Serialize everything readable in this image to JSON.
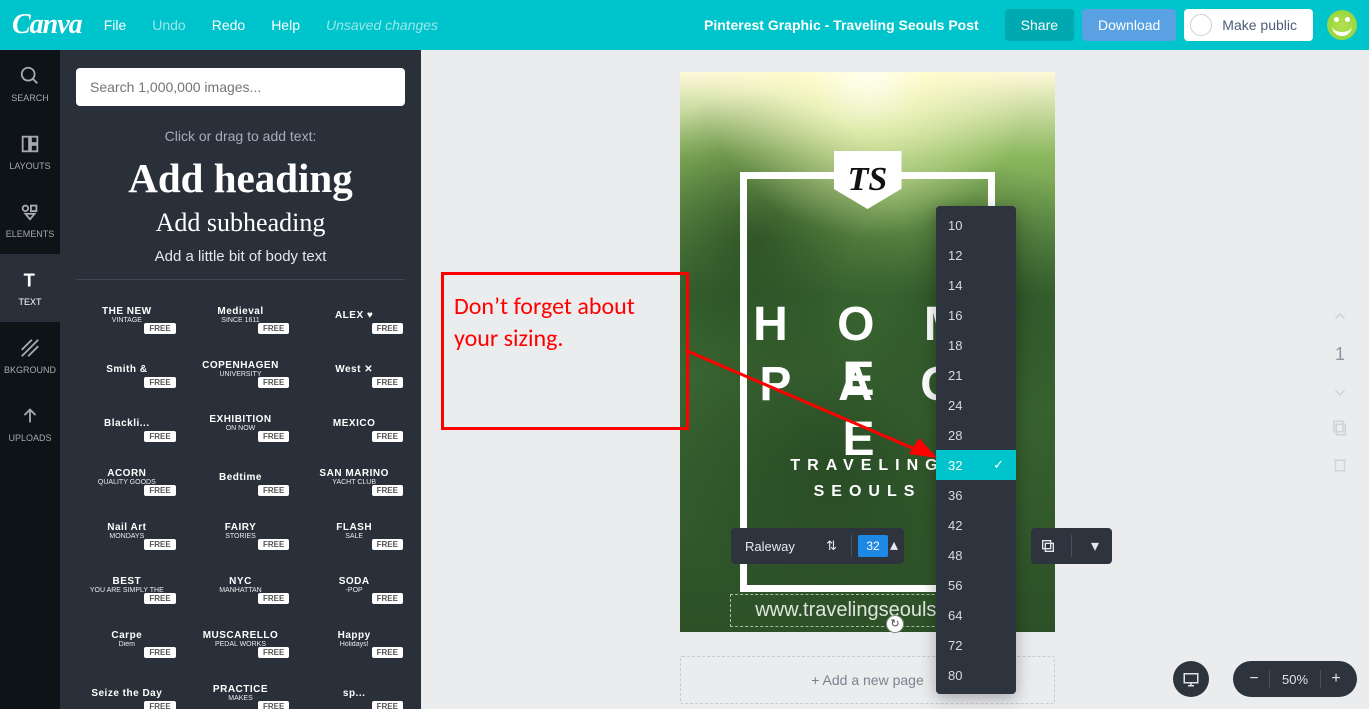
{
  "topbar": {
    "logo": "Canva",
    "menu": {
      "file": "File",
      "undo": "Undo",
      "redo": "Redo",
      "help": "Help",
      "status": "Unsaved changes"
    },
    "document_title": "Pinterest Graphic - Traveling Seouls Post",
    "share": "Share",
    "download": "Download",
    "make_public": "Make public"
  },
  "leftnav": {
    "search": "SEARCH",
    "layouts": "LAYOUTS",
    "elements": "ELEMENTS",
    "text": "TEXT",
    "bkground": "BKGROUND",
    "uploads": "UPLOADS"
  },
  "panel": {
    "search_placeholder": "Search 1,000,000 images...",
    "hint": "Click or drag to add text:",
    "add_heading": "Add heading",
    "add_subheading": "Add subheading",
    "add_body": "Add a little bit of body text",
    "free": "FREE",
    "thumbs": [
      {
        "l1": "THE NEW",
        "l2": "VINTAGE"
      },
      {
        "l1": "Medieval",
        "l2": "SINCE 1611"
      },
      {
        "l1": "ALEX ♥",
        "l2": ""
      },
      {
        "l1": "Smith &",
        "l2": ""
      },
      {
        "l1": "COPENHAGEN",
        "l2": "UNIVERSITY"
      },
      {
        "l1": "West ✕",
        "l2": ""
      },
      {
        "l1": "Blackli...",
        "l2": ""
      },
      {
        "l1": "EXHIBITION",
        "l2": "ON NOW"
      },
      {
        "l1": "MEXICO",
        "l2": ""
      },
      {
        "l1": "ACORN",
        "l2": "QUALITY GOODS"
      },
      {
        "l1": "Bedtime",
        "l2": ""
      },
      {
        "l1": "SAN MARINO",
        "l2": "YACHT CLUB"
      },
      {
        "l1": "Nail Art",
        "l2": "MONDAYS"
      },
      {
        "l1": "FAIRY",
        "l2": "STORIES"
      },
      {
        "l1": "FLASH",
        "l2": "SALE"
      },
      {
        "l1": "BEST",
        "l2": "YOU ARE SIMPLY THE"
      },
      {
        "l1": "NYC",
        "l2": "MANHATTAN"
      },
      {
        "l1": "SODA",
        "l2": "-POP"
      },
      {
        "l1": "Carpe",
        "l2": "Diem"
      },
      {
        "l1": "MUSCARELLO",
        "l2": "PEDAL WORKS"
      },
      {
        "l1": "Happy",
        "l2": "Holidays!"
      },
      {
        "l1": "Seize the Day",
        "l2": ""
      },
      {
        "l1": "PRACTICE",
        "l2": "MAKES"
      },
      {
        "l1": "sp...",
        "l2": ""
      }
    ]
  },
  "artboard": {
    "shield": "TS",
    "h1a": "H O M E",
    "h1b": "P A G E",
    "sub1": "TRAVELING",
    "sub2": "SEOULS",
    "url": "www.travelingseouls.com"
  },
  "toolbar": {
    "font": "Raleway",
    "size": "32"
  },
  "size_dropdown": {
    "options": [
      "10",
      "12",
      "14",
      "16",
      "18",
      "21",
      "24",
      "28",
      "32",
      "36",
      "42",
      "48",
      "56",
      "64",
      "72",
      "80"
    ],
    "selected": "32"
  },
  "annotation": {
    "text": "Don’t forget about your sizing."
  },
  "page": {
    "current": "1",
    "add_new": "+ Add a new page"
  },
  "zoom": {
    "value": "50%"
  }
}
